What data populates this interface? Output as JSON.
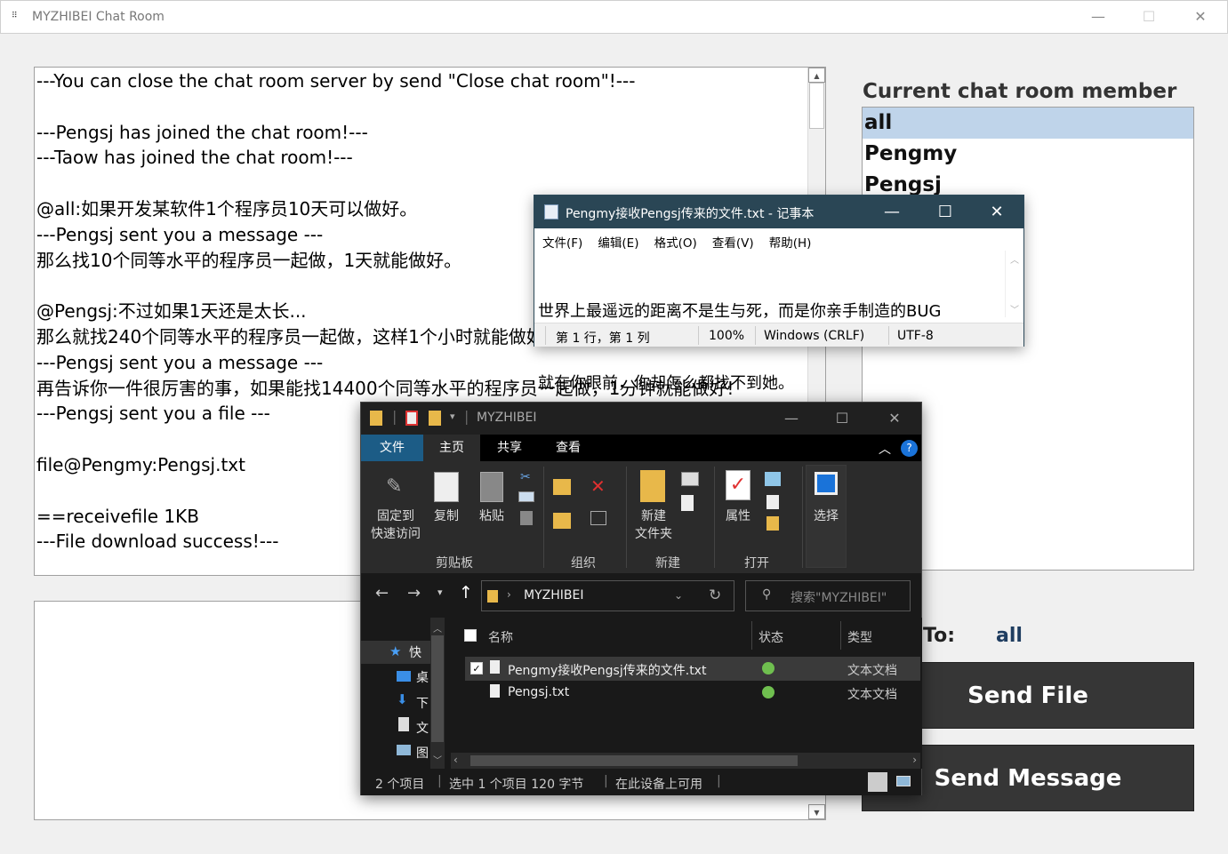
{
  "window": {
    "title": "MYZHIBEI Chat Room",
    "icon": "app-icon"
  },
  "chat_log": {
    "lines": [
      "---You can close the chat room server by send \"Close chat room\"!---",
      "",
      "---Pengsj has joined the chat room!---",
      "---Taow has joined the chat room!---",
      "",
      "@all:如果开发某软件1个程序员10天可以做好。",
      "---Pengsj sent you a message ---",
      "那么找10个同等水平的程序员一起做，1天就能做好。",
      "",
      "@Pengsj:不过如果1天还是太长...",
      "那么就找240个同等水平的程序员一起做，这样1个小时就能做好。",
      "---Pengsj sent you a message ---",
      "再告诉你一件很厉害的事，如果能找14400个同等水平的程序员一起做，1分钟就能做好!",
      "---Pengsj sent you a file ---",
      "",
      "file@Pengmy:Pengsj.txt",
      "",
      "==receivefile 1KB",
      "---File download success!---"
    ]
  },
  "members": {
    "label": "Current chat room member",
    "items": [
      "all",
      "Pengmy",
      "Pengsj"
    ],
    "selected": 0
  },
  "target": {
    "label": "To:",
    "value": "all"
  },
  "buttons": {
    "send_file": "Send File",
    "send_message": "Send Message"
  },
  "notepad": {
    "title": "Pengmy接收Pengsj传来的文件.txt - 记事本",
    "menu": [
      "文件(F)",
      "编辑(E)",
      "格式(O)",
      "查看(V)",
      "帮助(H)"
    ],
    "text_lines": [
      "世界上最遥远的距离不是生与死，而是你亲手制造的BUG",
      "就在你眼前，你却怎么都找不到她。"
    ],
    "status": {
      "position": "第 1 行，第 1 列",
      "zoom": "100%",
      "line_ending": "Windows (CRLF)",
      "encoding": "UTF-8"
    }
  },
  "explorer": {
    "title": "MYZHIBEI",
    "tabs": [
      "文件",
      "主页",
      "共享",
      "查看"
    ],
    "ribbon": {
      "pin": [
        "固定到",
        "快速访问"
      ],
      "copy": "复制",
      "paste": "粘贴",
      "new_folder": [
        "新建",
        "文件夹"
      ],
      "properties": "属性",
      "select": "选择",
      "groups": [
        "剪贴板",
        "组织",
        "新建",
        "打开"
      ]
    },
    "address": "MYZHIBEI",
    "search_placeholder": "搜索\"MYZHIBEI\"",
    "nav": [
      "快",
      "桌",
      "下",
      "文",
      "图"
    ],
    "columns": [
      "名称",
      "状态",
      "类型"
    ],
    "files": [
      {
        "name": "Pengmy接收Pengsj传来的文件.txt",
        "type": "文本文档",
        "selected": true
      },
      {
        "name": "Pengsj.txt",
        "type": "文本文档",
        "selected": false
      }
    ],
    "status": {
      "count": "2 个项目",
      "selection": "选中 1 个项目  120 字节",
      "availability": "在此设备上可用"
    }
  }
}
